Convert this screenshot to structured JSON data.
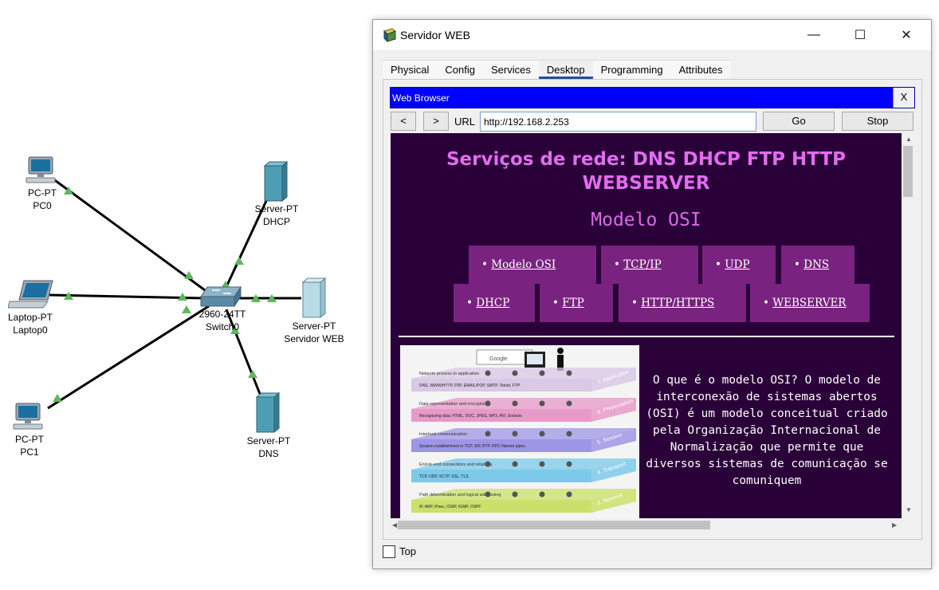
{
  "topology": {
    "devices": [
      {
        "id": "pc0",
        "type_label": "PC-PT",
        "name_label": "PC0"
      },
      {
        "id": "laptop0",
        "type_label": "Laptop-PT",
        "name_label": "Laptop0"
      },
      {
        "id": "pc1",
        "type_label": "PC-PT",
        "name_label": "PC1"
      },
      {
        "id": "switch0",
        "type_label": "2960-24TT",
        "name_label": "Switch0"
      },
      {
        "id": "dhcp",
        "type_label": "Server-PT",
        "name_label": "DHCP"
      },
      {
        "id": "webserver",
        "type_label": "Server-PT",
        "name_label": "Servidor WEB"
      },
      {
        "id": "dns",
        "type_label": "Server-PT",
        "name_label": "DNS"
      }
    ],
    "link_color": "#000000",
    "link_status_color": "#5cb85c"
  },
  "window": {
    "title": "Servidor WEB",
    "icon": "server-window-icon",
    "controls": {
      "minimize": "—",
      "maximize": "☐",
      "close": "✕"
    },
    "tabs": [
      "Physical",
      "Config",
      "Services",
      "Desktop",
      "Programming",
      "Attributes"
    ],
    "active_tab": "Desktop",
    "top_checkbox": {
      "label": "Top",
      "checked": false
    }
  },
  "browser": {
    "title": "Web Browser",
    "close_label": "X",
    "back_label": "<",
    "forward_label": ">",
    "url_label": "URL",
    "url_value": "http://192.168.2.253",
    "go_label": "Go",
    "stop_label": "Stop",
    "title_bar_color": "#0000ff"
  },
  "page": {
    "heading": "Serviços de rede: DNS DHCP FTP HTTP WEBSERVER",
    "subheading": "Modelo OSI",
    "menu": [
      [
        "Modelo OSI",
        "TCP/IP",
        "UDP",
        "DNS"
      ],
      [
        "DHCP",
        "FTP",
        "HTTP/HTTPS",
        "WEBSERVER"
      ]
    ],
    "bullet": "•",
    "paragraph": "O que é o modelo OSI? O modelo de interconexão de sistemas abertos (OSI) é um modelo conceitual criado pela Organização Internacional de Normalização que permite que diversos sistemas de comunicação se comuniquem",
    "colors": {
      "background": "#2a0038",
      "heading": "#e26cf0",
      "menu_bg": "#7a2280",
      "text": "#ffffff"
    },
    "image": {
      "layers": [
        {
          "num": "7. Application",
          "caption": "Network process to application",
          "sub": "DNS, WWW/HTTP, P2P, EMAIL/POP, SMTP, Telnet, FTP",
          "color": "#d9c8e6"
        },
        {
          "num": "6. Presentation",
          "caption": "Data representation and encryption",
          "sub": "Recognizing data: HTML, DOC, JPEG, MP3, AVI, Sockets",
          "color": "#e79ac8"
        },
        {
          "num": "5. Session",
          "caption": "Interhost communication",
          "sub": "Session establishment in TCP, SIP, RTP, RPC-Named pipes",
          "color": "#9d95e6"
        },
        {
          "num": "4. Transport",
          "caption": "End-to-end connections and reliability",
          "sub": "TCP, UDP, SCTP, SSL, TLS",
          "color": "#7cc9ea"
        },
        {
          "num": "3. Network",
          "caption": "Path determination and logical addressing",
          "sub": "IP, ARP, IPsec, ICMP, IGMP, OSPF",
          "color": "#c9e06a"
        }
      ],
      "top_label": "Google"
    }
  }
}
